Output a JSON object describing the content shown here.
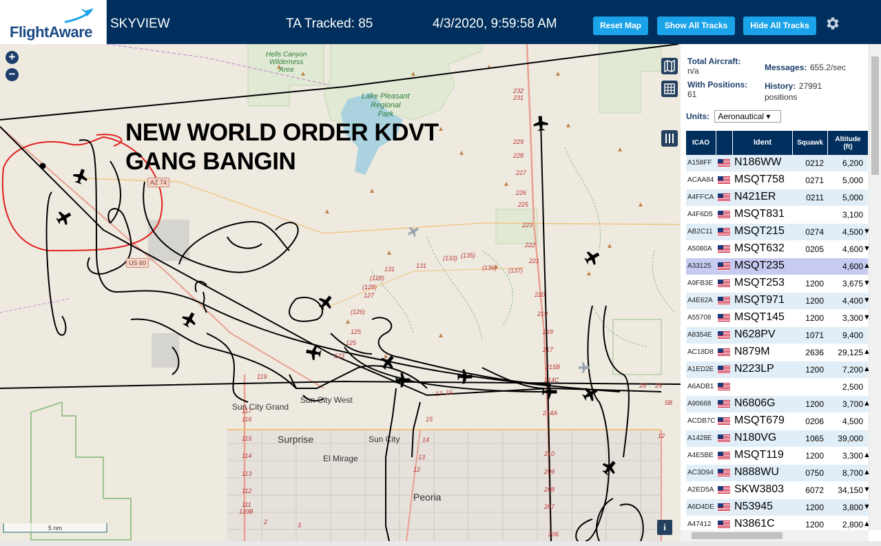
{
  "header": {
    "brand": "FlightAware",
    "app_title": "SKYVIEW",
    "tracked": "TA Tracked: 85",
    "clock": "4/3/2020, 9:59:58 AM",
    "buttons": {
      "reset": "Reset Map",
      "show_all": "Show All Tracks",
      "hide_all": "Hide All Tracks"
    },
    "colors": {
      "bar": "#002f5d",
      "button": "#1aa3e8"
    }
  },
  "map": {
    "annotation_line1": "NEW WORLD ORDER KDVT",
    "annotation_line2": "GANG BANGIN",
    "places": {
      "surprise": "Surprise",
      "sun_city": "Sun City",
      "sun_city_grand": "Sun City Grand",
      "sun_city_west": "Sun City West",
      "el_mirage": "El Mirage",
      "peoria": "Peoria"
    },
    "parks": {
      "hells_canyon": "Hells Canyon\nWilderness\nArea",
      "lake_pleasant": "Lake Pleasant\nRegional\nPark"
    },
    "shields": {
      "az74": "AZ 74",
      "us60": "US 60"
    },
    "road_numbers": {
      "r232": "232",
      "r231": "231",
      "r229": "229",
      "r228": "228",
      "r227": "227",
      "r226": "226",
      "r225": "225",
      "r223": "223",
      "r222": "222",
      "r221": "221",
      "r220": "220",
      "r219": "219",
      "r218": "218",
      "r217": "217",
      "r215b": "215B",
      "r214c": "214C",
      "r214a": "214A",
      "r210": "210",
      "r209": "209",
      "r208": "208",
      "r207": "207",
      "r206": "206",
      "r131a": "131",
      "r131b": "131",
      "r133": "(133)",
      "r135": "(135)",
      "r136": "(136)",
      "r137": "(137)",
      "r128a": "(128)",
      "r128b": "(128)",
      "r127": "127",
      "r126": "(126)",
      "r125a": "125",
      "r125b": "125",
      "r123": "123",
      "r119": "119",
      "r117": "117",
      "r116": "116",
      "r115": "115",
      "r114": "114",
      "r113": "113",
      "r112": "112",
      "r111": "111",
      "r110b": "110B",
      "r17": "17",
      "r16": "16",
      "r15": "15",
      "r14": "14",
      "r13": "13",
      "r12": "12",
      "r28": "28",
      "r29": "29",
      "r5b": "5B",
      "r2": "2",
      "r3": "3"
    },
    "scale": "5 nm",
    "info_icon": "i",
    "zoom_in": "+",
    "zoom_out": "−"
  },
  "stats": {
    "total_aircraft_label": "Total Aircraft:",
    "total_aircraft_value": "n/a",
    "with_positions_label": "With Positions:",
    "with_positions_value": "61",
    "messages_label": "Messages:",
    "messages_value": "655.2/sec",
    "history_label": "History:",
    "history_value": "27991",
    "history_unit": "positions",
    "units_label": "Units:",
    "units_value": "Aeronautical ▾"
  },
  "table": {
    "headers": {
      "icao": "ICAO",
      "ident": "Ident",
      "squawk": "Squawk",
      "altitude": "Altitude\n(ft)"
    },
    "rows": [
      {
        "icao": "A158FF",
        "ident": "N186WW",
        "squawk": "0212",
        "alt": "6,200",
        "trend": ""
      },
      {
        "icao": "ACAA84",
        "ident": "MSQT758",
        "squawk": "0271",
        "alt": "5,000",
        "trend": ""
      },
      {
        "icao": "A4FFCA",
        "ident": "N421ER",
        "squawk": "0211",
        "alt": "5,000",
        "trend": ""
      },
      {
        "icao": "A4F6D5",
        "ident": "MSQT831",
        "squawk": "",
        "alt": "3,100",
        "trend": ""
      },
      {
        "icao": "AB2C11",
        "ident": "MSQT215",
        "squawk": "0274",
        "alt": "4,500",
        "trend": "▼"
      },
      {
        "icao": "A5080A",
        "ident": "MSQT632",
        "squawk": "0205",
        "alt": "4,600",
        "trend": "▼"
      },
      {
        "icao": "A33125",
        "ident": "MSQT235",
        "squawk": "",
        "alt": "4,600",
        "trend": "▲",
        "selected": true
      },
      {
        "icao": "A9FB3E",
        "ident": "MSQT253",
        "squawk": "1200",
        "alt": "3,675",
        "trend": "▼"
      },
      {
        "icao": "A4E62A",
        "ident": "MSQT971",
        "squawk": "1200",
        "alt": "4,400",
        "trend": "▼"
      },
      {
        "icao": "A55708",
        "ident": "MSQT145",
        "squawk": "1200",
        "alt": "3,300",
        "trend": "▼"
      },
      {
        "icao": "A8354E",
        "ident": "N628PV",
        "squawk": "1071",
        "alt": "9,400",
        "trend": ""
      },
      {
        "icao": "AC18D8",
        "ident": "N879M",
        "squawk": "2636",
        "alt": "29,125",
        "trend": "▲"
      },
      {
        "icao": "A1ED2E",
        "ident": "N223LP",
        "squawk": "1200",
        "alt": "7,200",
        "trend": "▲"
      },
      {
        "icao": "A6ADB1",
        "ident": "",
        "squawk": "",
        "alt": "2,500",
        "trend": ""
      },
      {
        "icao": "A90668",
        "ident": "N6806G",
        "squawk": "1200",
        "alt": "3,700",
        "trend": "▲"
      },
      {
        "icao": "ACDB7C",
        "ident": "MSQT679",
        "squawk": "0206",
        "alt": "4,500",
        "trend": ""
      },
      {
        "icao": "A1428E",
        "ident": "N180VG",
        "squawk": "1065",
        "alt": "39,000",
        "trend": ""
      },
      {
        "icao": "A4E5BE",
        "ident": "MSQT119",
        "squawk": "1200",
        "alt": "3,300",
        "trend": "▲"
      },
      {
        "icao": "AC3D94",
        "ident": "N888WU",
        "squawk": "0750",
        "alt": "8,700",
        "trend": "▲"
      },
      {
        "icao": "A2ED5A",
        "ident": "SKW3803",
        "squawk": "6072",
        "alt": "34,150",
        "trend": "▼"
      },
      {
        "icao": "A6D4DE",
        "ident": "N53945",
        "squawk": "1200",
        "alt": "3,800",
        "trend": "▼"
      },
      {
        "icao": "A47412",
        "ident": "N3861C",
        "squawk": "1200",
        "alt": "2,800",
        "trend": "▲"
      }
    ]
  }
}
